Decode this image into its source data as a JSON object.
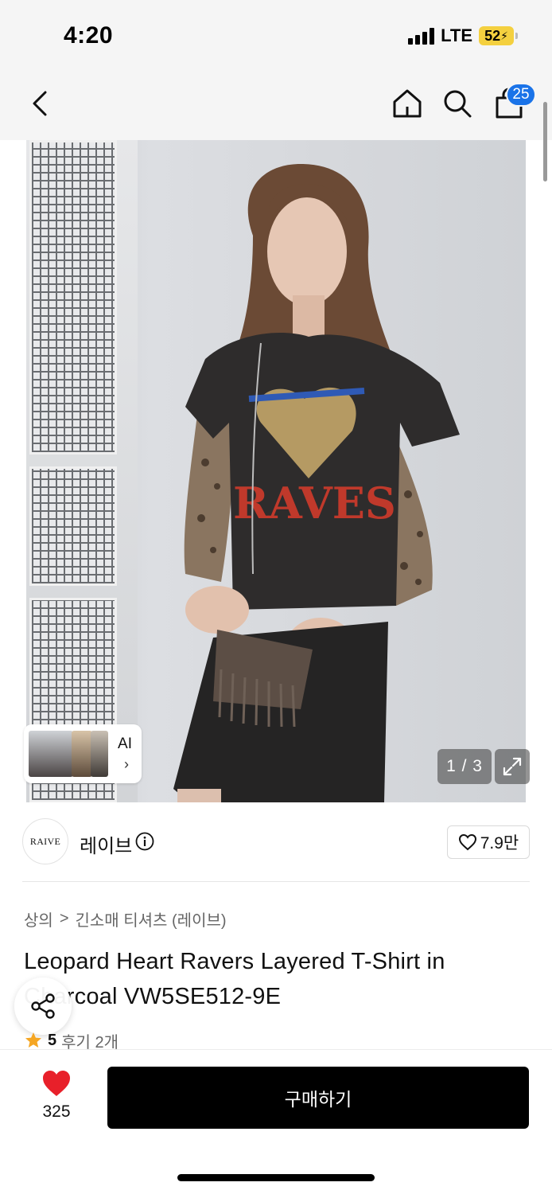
{
  "status": {
    "time": "4:20",
    "network": "LTE",
    "battery": "52"
  },
  "nav": {
    "cart_count": "25"
  },
  "gallery": {
    "counter": "1 / 3",
    "ai_label": "AI"
  },
  "brand": {
    "logo_text": "RAIVE",
    "name": "레이브",
    "likes": "7.9만"
  },
  "breadcrumb": {
    "category": "상의",
    "separator": ">",
    "subcategory": "긴소매 티셔츠 (레이브)"
  },
  "product": {
    "title": "Leopard Heart Ravers Layered T-Shirt in Charcoal VW5SE512-9E",
    "rating": "5",
    "reviews": "후기 2개"
  },
  "bottom": {
    "wish_count": "325",
    "buy_label": "구매하기"
  },
  "colors": {
    "accent_badge": "#1a73e8",
    "heart": "#e8202a",
    "star": "#f5a623",
    "buy_button": "#000000"
  }
}
